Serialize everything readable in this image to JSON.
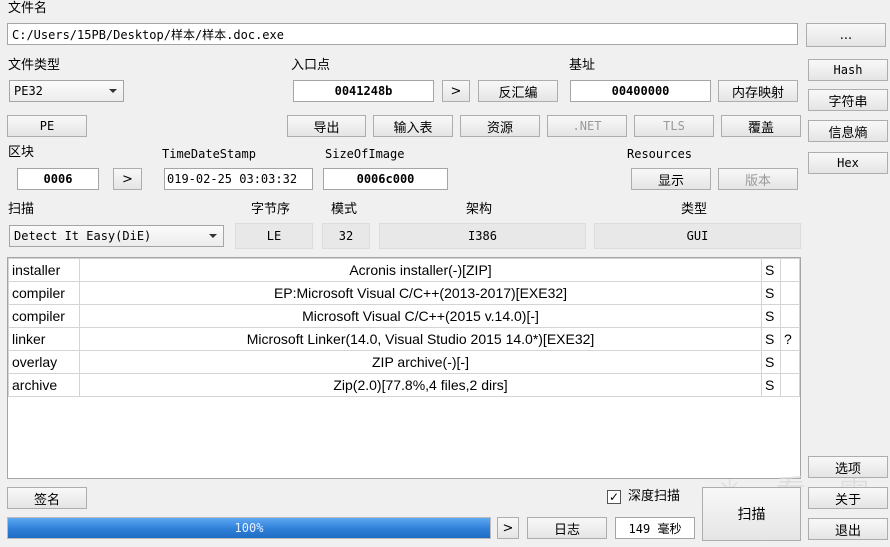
{
  "file_name": {
    "label": "文件名",
    "path": "C:/Users/15PB/Desktop/样本/样本.doc.exe",
    "browse_label": "..."
  },
  "file_type": {
    "label": "文件类型",
    "selected": "PE32"
  },
  "entry_point": {
    "label": "入口点",
    "value": "0041248b",
    "next_label": ">",
    "disasm_label": "反汇编"
  },
  "base_address": {
    "label": "基址",
    "value": "00400000",
    "memory_map_label": "内存映射"
  },
  "row2_buttons": {
    "pe": "PE",
    "export": "导出",
    "import": "输入表",
    "resources": "资源",
    "net": ".NET",
    "tls": "TLS",
    "overlay": "覆盖"
  },
  "sections": {
    "label": "区块",
    "value": "0006",
    "next_label": ">"
  },
  "time_date_stamp": {
    "label": "TimeDateStamp",
    "value": "019-02-25 03:03:32"
  },
  "size_of_image": {
    "label": "SizeOfImage",
    "value": "0006c000"
  },
  "resources": {
    "label": "Resources",
    "show_label": "显示",
    "version_label": "版本"
  },
  "scan": {
    "label": "扫描",
    "selected": "Detect It Easy(DiE)"
  },
  "endianness": {
    "label": "字节序",
    "value": "LE"
  },
  "mode": {
    "label": "模式",
    "value": "32"
  },
  "arch": {
    "label": "架构",
    "value": "I386"
  },
  "type": {
    "label": "类型",
    "value": "GUI"
  },
  "results": [
    {
      "type": "installer",
      "name": "Acronis installer(-)[ZIP]",
      "s": "S",
      "q": ""
    },
    {
      "type": "compiler",
      "name": "EP:Microsoft Visual C/C++(2013-2017)[EXE32]",
      "s": "S",
      "q": ""
    },
    {
      "type": "compiler",
      "name": "Microsoft Visual C/C++(2015 v.14.0)[-]",
      "s": "S",
      "q": ""
    },
    {
      "type": "linker",
      "name": "Microsoft Linker(14.0, Visual Studio 2015 14.0*)[EXE32]",
      "s": "S",
      "q": "?"
    },
    {
      "type": "overlay",
      "name": "ZIP archive(-)[-]",
      "s": "S",
      "q": ""
    },
    {
      "type": "archive",
      "name": "Zip(2.0)[77.8%,4 files,2 dirs]",
      "s": "S",
      "q": ""
    }
  ],
  "side_buttons": {
    "hash": "Hash",
    "strings": "字符串",
    "entropy": "信息熵",
    "hex": "Hex"
  },
  "bottom": {
    "signature_label": "签名",
    "deep_scan_label": "深度扫描",
    "deep_scan_checked": true,
    "scan_button_label": "扫描",
    "progress_text": "100%",
    "progress_fraction": 1.0,
    "progress_next_label": ">",
    "log_label": "日志",
    "elapsed": "149 毫秒",
    "options_label": "选项",
    "about_label": "关于",
    "exit_label": "退出"
  },
  "colors": {
    "progress_fill": "#2f7fd8",
    "window_bg": "#f0f0f0"
  }
}
